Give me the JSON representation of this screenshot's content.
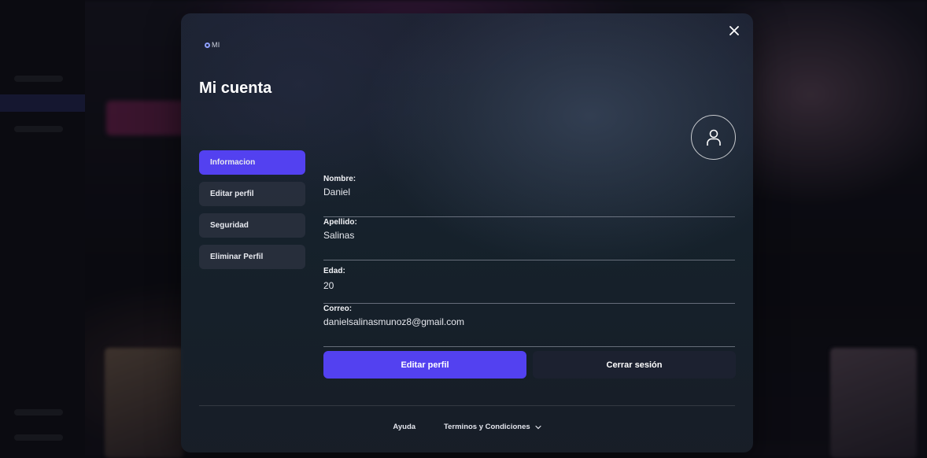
{
  "brand": {
    "label": "MI"
  },
  "modal": {
    "title": "Mi cuenta"
  },
  "menu": {
    "items": [
      {
        "label": "Informacion"
      },
      {
        "label": "Editar perfil"
      },
      {
        "label": "Seguridad"
      },
      {
        "label": "Eliminar Perfil"
      }
    ],
    "active": 0
  },
  "fields": [
    {
      "label": "Nombre:",
      "value": "Daniel"
    },
    {
      "label": "Apellido:",
      "value": "Salinas"
    },
    {
      "label": "Edad:",
      "value": "20"
    },
    {
      "label": "Correo:",
      "value": "danielsalinasmunoz8@gmail.com"
    }
  ],
  "actions": {
    "edit_label": "Editar perfil",
    "logout_label": "Cerrar sesión"
  },
  "footer": {
    "help_label": "Ayuda",
    "terms_label": "Terminos y Condiciones"
  },
  "colors": {
    "accent": "#5341f0",
    "secondary_button": "#1c2130"
  }
}
